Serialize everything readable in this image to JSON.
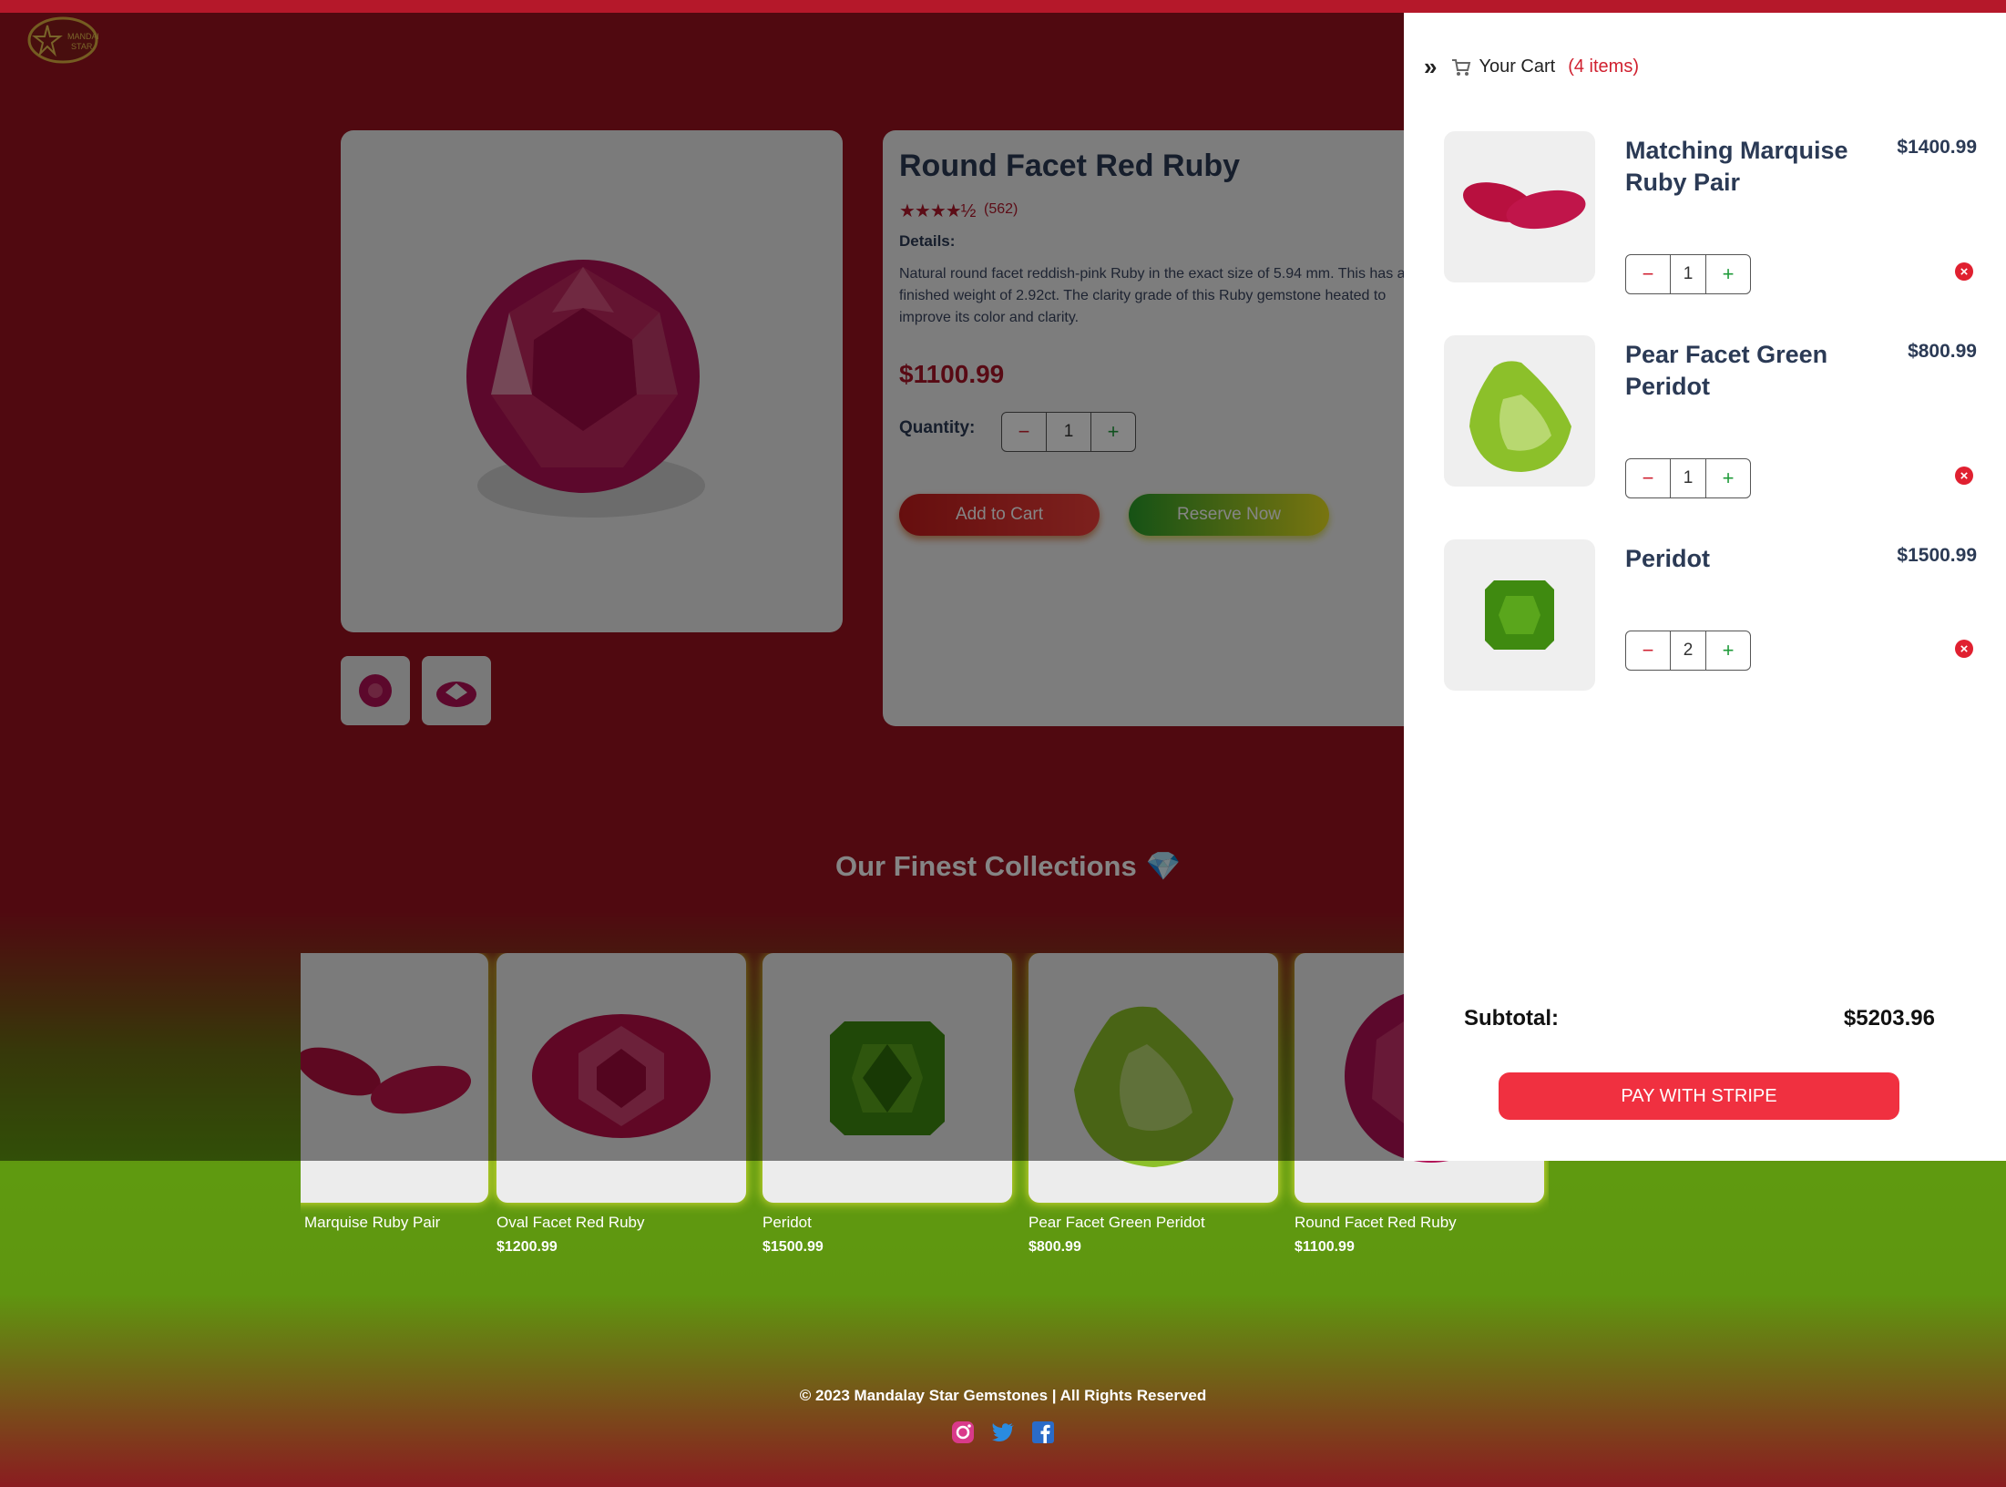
{
  "brand": {
    "logo_alt": "Mandalay Star",
    "logo_text_line1": "MANDALAY",
    "logo_text_line2": "STAR"
  },
  "product": {
    "title": "Round Facet Red Ruby",
    "stars": "★★★★½",
    "rating": 4.5,
    "reviews": "(562)",
    "details_label": "Details:",
    "description": "Natural round facet reddish-pink Ruby in the exact size of 5.94 mm. This has a finished weight of 2.92ct. The clarity grade of this Ruby gemstone heated to improve its color and clarity.",
    "price": "$1100.99",
    "quantity_label": "Quantity:",
    "quantity": "1",
    "add_to_cart": "Add to Cart",
    "reserve_now": "Reserve Now"
  },
  "collections": {
    "title": "Our Finest Collections",
    "emoji": "💎",
    "items": [
      {
        "name": "Marquise Ruby Pair",
        "price": ""
      },
      {
        "name": "Oval Facet Red Ruby",
        "price": "$1200.99"
      },
      {
        "name": "Peridot",
        "price": "$1500.99"
      },
      {
        "name": "Pear Facet Green Peridot",
        "price": "$800.99"
      },
      {
        "name": "Round Facet Red Ruby",
        "price": "$1100.99"
      }
    ]
  },
  "footer": {
    "copyright": "© 2023 Mandalay Star Gemstones | All Rights Reserved"
  },
  "cart": {
    "collapse_icon": "»",
    "title": "Your Cart",
    "count": "(4 items)",
    "items": [
      {
        "name": "Matching Marquise Ruby Pair",
        "price": "$1400.99",
        "qty": "1"
      },
      {
        "name": "Pear Facet Green Peridot",
        "price": "$800.99",
        "qty": "1"
      },
      {
        "name": "Peridot",
        "price": "$1500.99",
        "qty": "2"
      }
    ],
    "subtotal_label": "Subtotal:",
    "subtotal_value": "$5203.96",
    "pay_button": "PAY WITH STRIPE"
  },
  "colors": {
    "accent_red": "#b5182a",
    "pay_red": "#f03040",
    "plus_green": "#1f9b3a"
  }
}
